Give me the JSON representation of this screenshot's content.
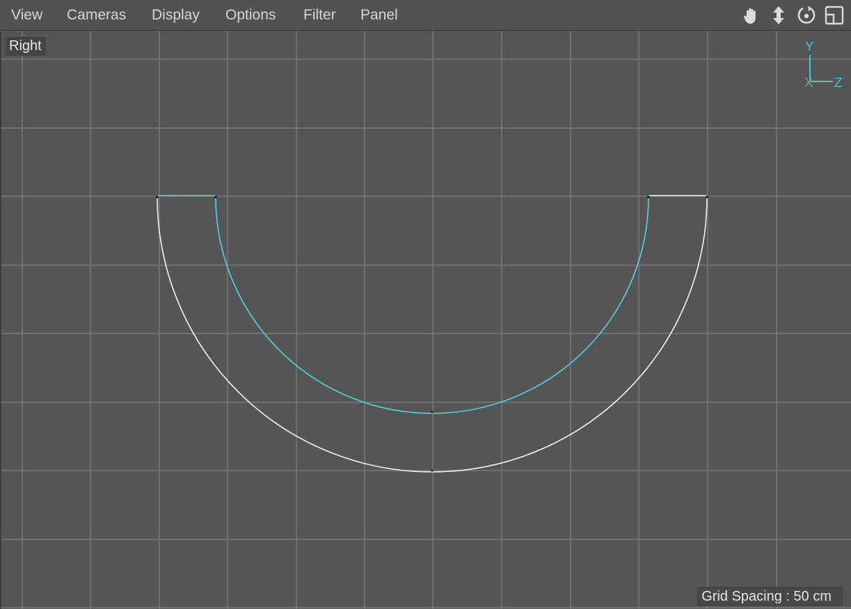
{
  "menu": {
    "items": [
      {
        "label": "View"
      },
      {
        "label": "Cameras"
      },
      {
        "label": "Display"
      },
      {
        "label": "Options"
      },
      {
        "label": "Filter"
      },
      {
        "label": "Panel"
      }
    ]
  },
  "toolbar": {
    "icons": [
      "hand-pan-icon",
      "move-arrows-icon",
      "orbit-icon",
      "panel-layout-icon"
    ]
  },
  "viewport": {
    "label": "Right",
    "grid_spacing": "Grid Spacing : 50 cm",
    "axis": {
      "y_label": "Y",
      "z_label": "Z",
      "x_label": "X"
    }
  },
  "colors": {
    "background": "#555555",
    "grid": "#7a7a7a",
    "spline_selected": "#4fd6e4",
    "spline_unselected": "#f2f2f2",
    "axis": "#37c9da"
  }
}
